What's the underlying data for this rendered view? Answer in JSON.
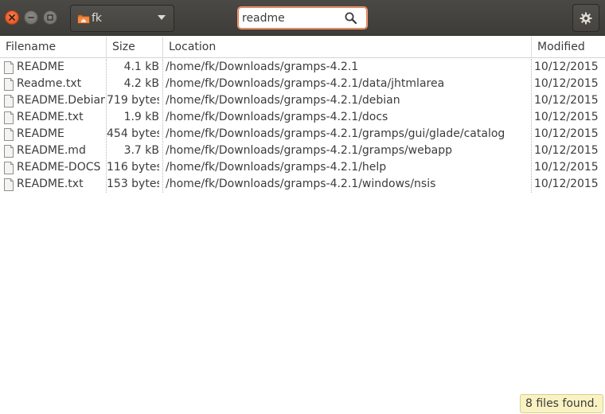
{
  "header": {
    "folder_label": "fk",
    "search_value": "readme"
  },
  "columns": {
    "filename": "Filename",
    "size": "Size",
    "location": "Location",
    "modified": "Modified"
  },
  "results": [
    {
      "name": "README",
      "size": "4.1 kB",
      "location": "/home/fk/Downloads/gramps-4.2.1",
      "modified": "10/12/2015"
    },
    {
      "name": "Readme.txt",
      "size": "4.2 kB",
      "location": "/home/fk/Downloads/gramps-4.2.1/data/jhtmlarea",
      "modified": "10/12/2015"
    },
    {
      "name": "README.Debian",
      "size": "719 bytes",
      "location": "/home/fk/Downloads/gramps-4.2.1/debian",
      "modified": "10/12/2015"
    },
    {
      "name": "README.txt",
      "size": "1.9 kB",
      "location": "/home/fk/Downloads/gramps-4.2.1/docs",
      "modified": "10/12/2015"
    },
    {
      "name": "README",
      "size": "454 bytes",
      "location": "/home/fk/Downloads/gramps-4.2.1/gramps/gui/glade/catalog",
      "modified": "10/12/2015"
    },
    {
      "name": "README.md",
      "size": "3.7 kB",
      "location": "/home/fk/Downloads/gramps-4.2.1/gramps/webapp",
      "modified": "10/12/2015"
    },
    {
      "name": "README-DOCS",
      "size": "116 bytes",
      "location": "/home/fk/Downloads/gramps-4.2.1/help",
      "modified": "10/12/2015"
    },
    {
      "name": "README.txt",
      "size": "153 bytes",
      "location": "/home/fk/Downloads/gramps-4.2.1/windows/nsis",
      "modified": "10/12/2015"
    }
  ],
  "status": "8 files found.",
  "icons": {
    "close": "close-icon",
    "minimize": "minimize-icon",
    "maximize": "maximize-icon",
    "folder": "home-folder-icon",
    "dropdown": "chevron-down-icon",
    "search": "search-icon",
    "settings": "gear-icon",
    "file": "text-file-icon"
  },
  "colors": {
    "headerbar": "#3f3e3a",
    "close_button": "#e9561c",
    "search_focus": "#e27e53",
    "status_bg": "#f9f2c2"
  }
}
